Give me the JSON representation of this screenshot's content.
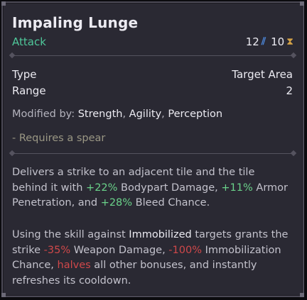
{
  "skill": {
    "name": "Impaling Lunge",
    "type": "Attack",
    "energy_cost": "12",
    "energy_icon": "energy-icon",
    "cooldown": "10",
    "cooldown_icon": "hourglass-icon"
  },
  "stats": [
    {
      "label": "Type",
      "value": "Target Area"
    },
    {
      "label": "Range",
      "value": "2"
    }
  ],
  "modified_by": {
    "label": "Modified by:",
    "attributes": [
      "Strength",
      "Agility",
      "Perception"
    ],
    "separator": ","
  },
  "requirement": "- Requires a spear",
  "description_1": {
    "t1": "Delivers a strike to an adjacent tile and the tile behind it with ",
    "v1": "+22%",
    "t2": " Bodypart Damage, ",
    "v2": "+11%",
    "t3": " Armor Penetration, and ",
    "v3": "+28%",
    "t4": " Bleed Chance."
  },
  "description_2": {
    "t1": "Using the skill against ",
    "k1": "Immobilized",
    "t2": " targets grants the strike ",
    "v1": "-35%",
    "t3": " Weapon Damage, ",
    "v2": "-100%",
    "t4": " Immobilization Chance, ",
    "v3": "halves",
    "t5": " all other bonuses, and instantly refreshes its cooldown."
  },
  "colors": {
    "panel": "#2a2933",
    "border": "#4b4955",
    "type_green": "#4fc79a",
    "positive": "#6ad28a",
    "negative": "#d0484a",
    "energy": "#4c86d8",
    "cooldown": "#d5a347",
    "requirement": "#9a9784"
  }
}
